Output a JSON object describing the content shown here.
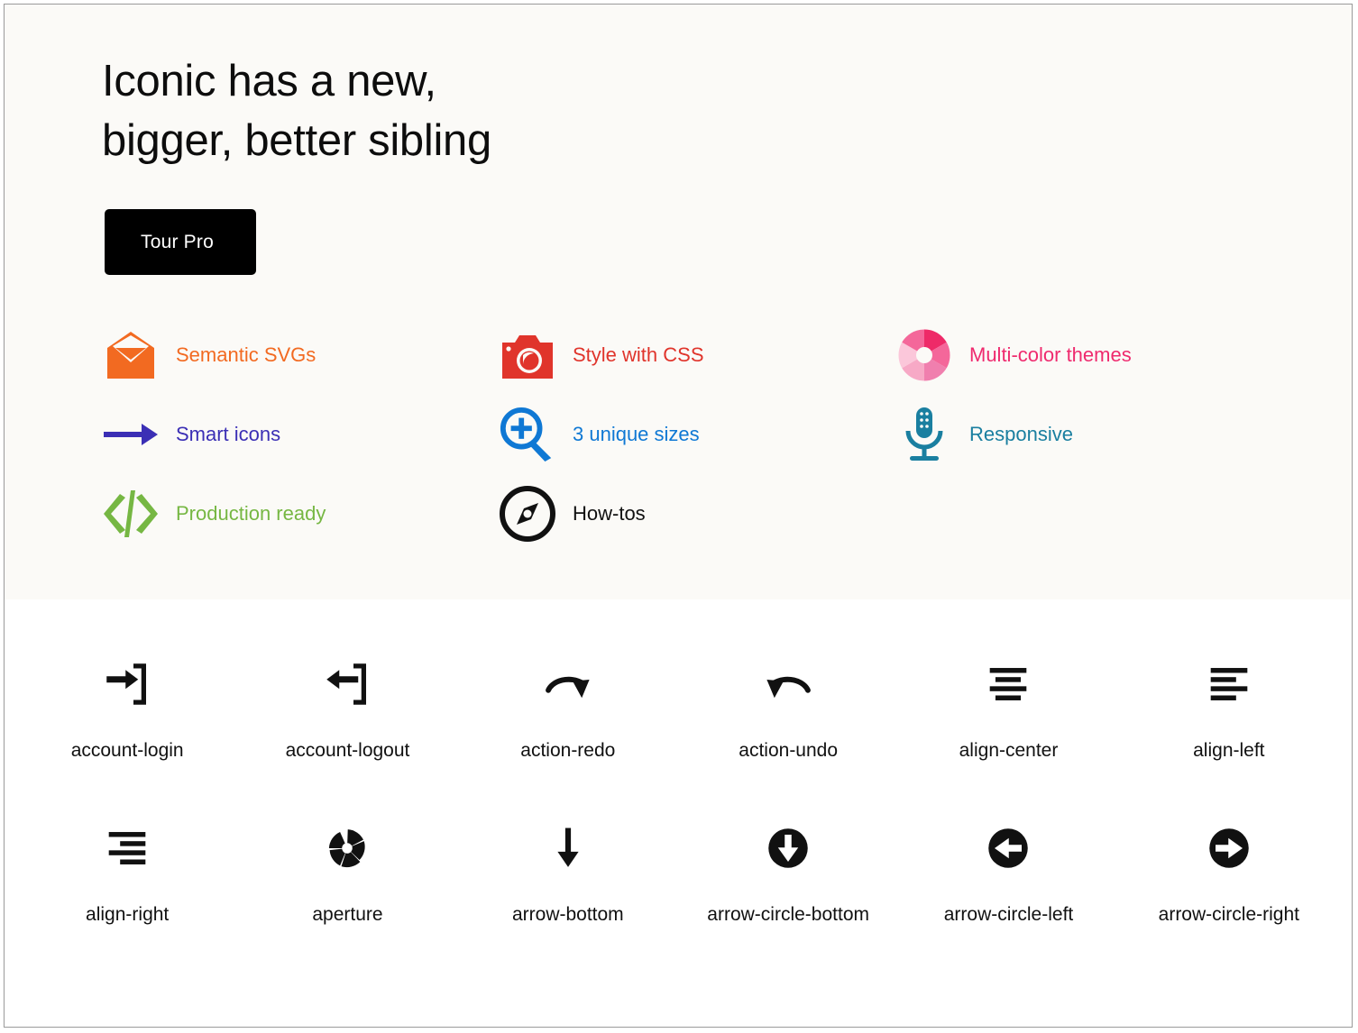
{
  "hero": {
    "title": "Iconic has a new,\nbigger, better sibling",
    "cta_label": "Tour Pro",
    "background_color": "#fbfaf7",
    "cta_background_color": "#000000",
    "cta_text_color": "#ffffff"
  },
  "features": [
    {
      "label": "Semantic SVGs",
      "icon": "envelope-open-icon",
      "color": "#f26a21"
    },
    {
      "label": "Style with CSS",
      "icon": "camera-icon",
      "color": "#e0342b"
    },
    {
      "label": "Multi-color themes",
      "icon": "aperture-color-icon",
      "color": "#ef2a6e"
    },
    {
      "label": "Smart icons",
      "icon": "arrow-right-icon",
      "color": "#3b2fb5"
    },
    {
      "label": "3 unique sizes",
      "icon": "zoom-in-icon",
      "color": "#0f78d4"
    },
    {
      "label": "Responsive",
      "icon": "microphone-icon",
      "color": "#1a7fa0"
    },
    {
      "label": "Production ready",
      "icon": "code-icon",
      "color": "#76b743"
    },
    {
      "label": "How-tos",
      "icon": "compass-icon",
      "color": "#111111"
    }
  ],
  "gallery": {
    "icons": [
      {
        "name": "account-login",
        "icon": "account-login-icon"
      },
      {
        "name": "account-logout",
        "icon": "account-logout-icon"
      },
      {
        "name": "action-redo",
        "icon": "action-redo-icon"
      },
      {
        "name": "action-undo",
        "icon": "action-undo-icon"
      },
      {
        "name": "align-center",
        "icon": "align-center-icon"
      },
      {
        "name": "align-left",
        "icon": "align-left-icon"
      },
      {
        "name": "align-right",
        "icon": "align-right-icon"
      },
      {
        "name": "aperture",
        "icon": "aperture-icon"
      },
      {
        "name": "arrow-bottom",
        "icon": "arrow-bottom-icon"
      },
      {
        "name": "arrow-circle-bottom",
        "icon": "arrow-circle-bottom-icon"
      },
      {
        "name": "arrow-circle-left",
        "icon": "arrow-circle-left-icon"
      },
      {
        "name": "arrow-circle-right",
        "icon": "arrow-circle-right-icon"
      }
    ]
  }
}
